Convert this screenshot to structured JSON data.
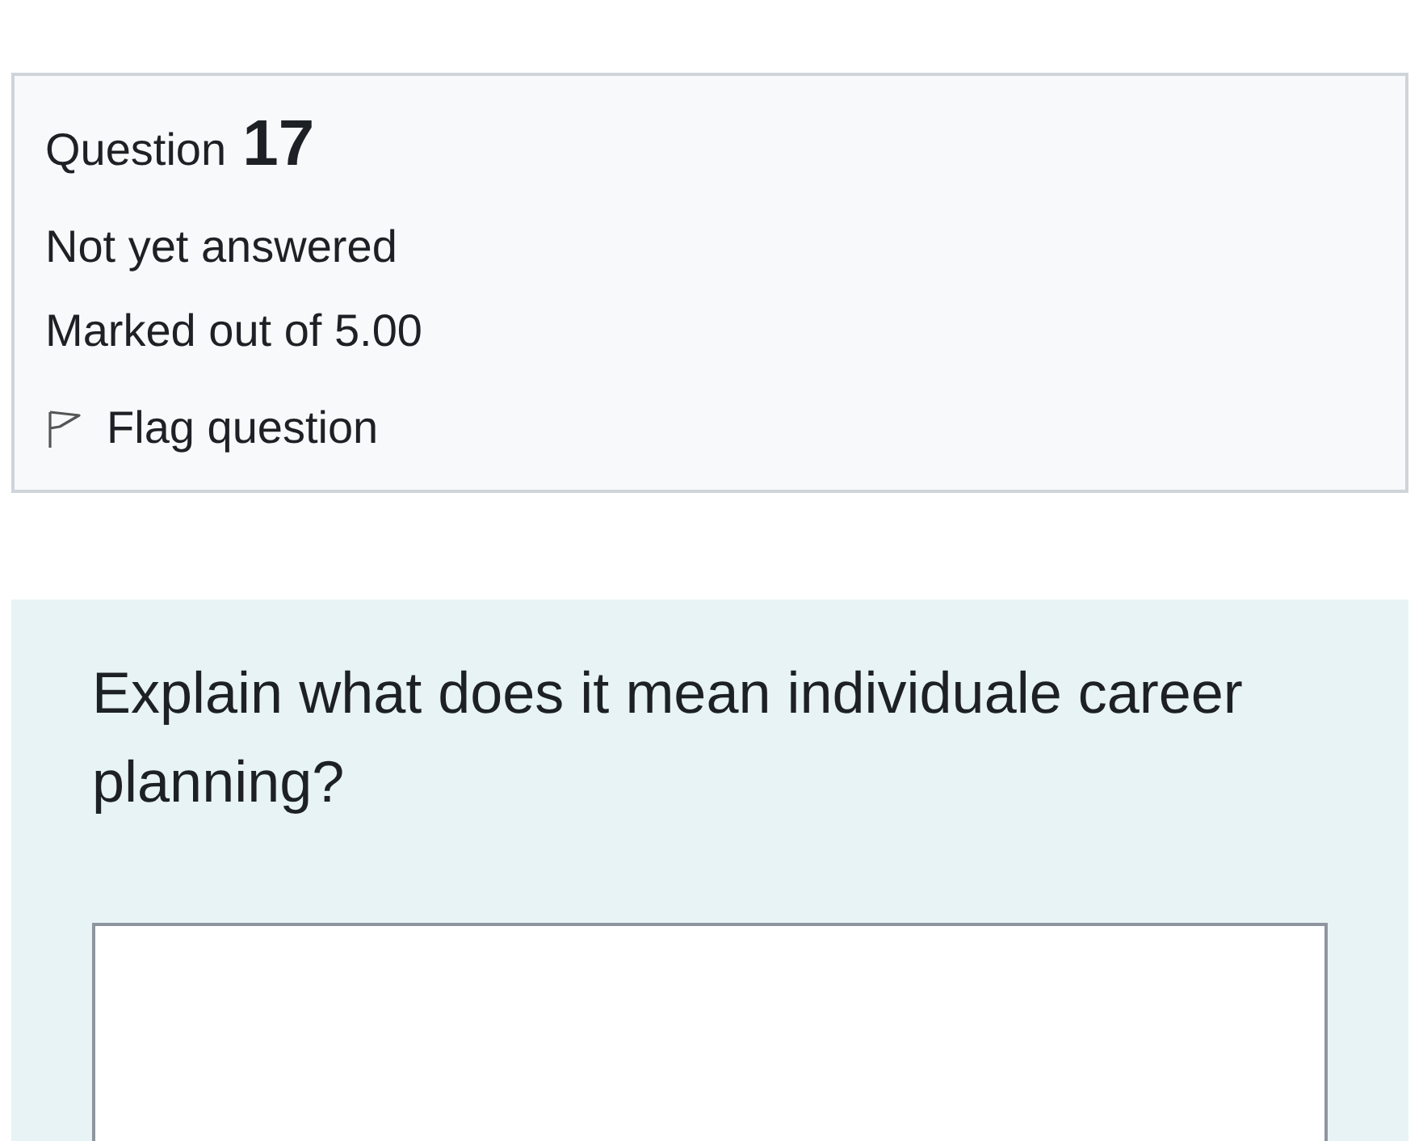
{
  "info": {
    "question_label": "Question",
    "question_number": "17",
    "status": "Not yet answered",
    "marks": "Marked out of 5.00",
    "flag": {
      "label": "Flag question",
      "flagged": false
    }
  },
  "question": {
    "text": "Explain what does it mean individuale career planning?"
  }
}
